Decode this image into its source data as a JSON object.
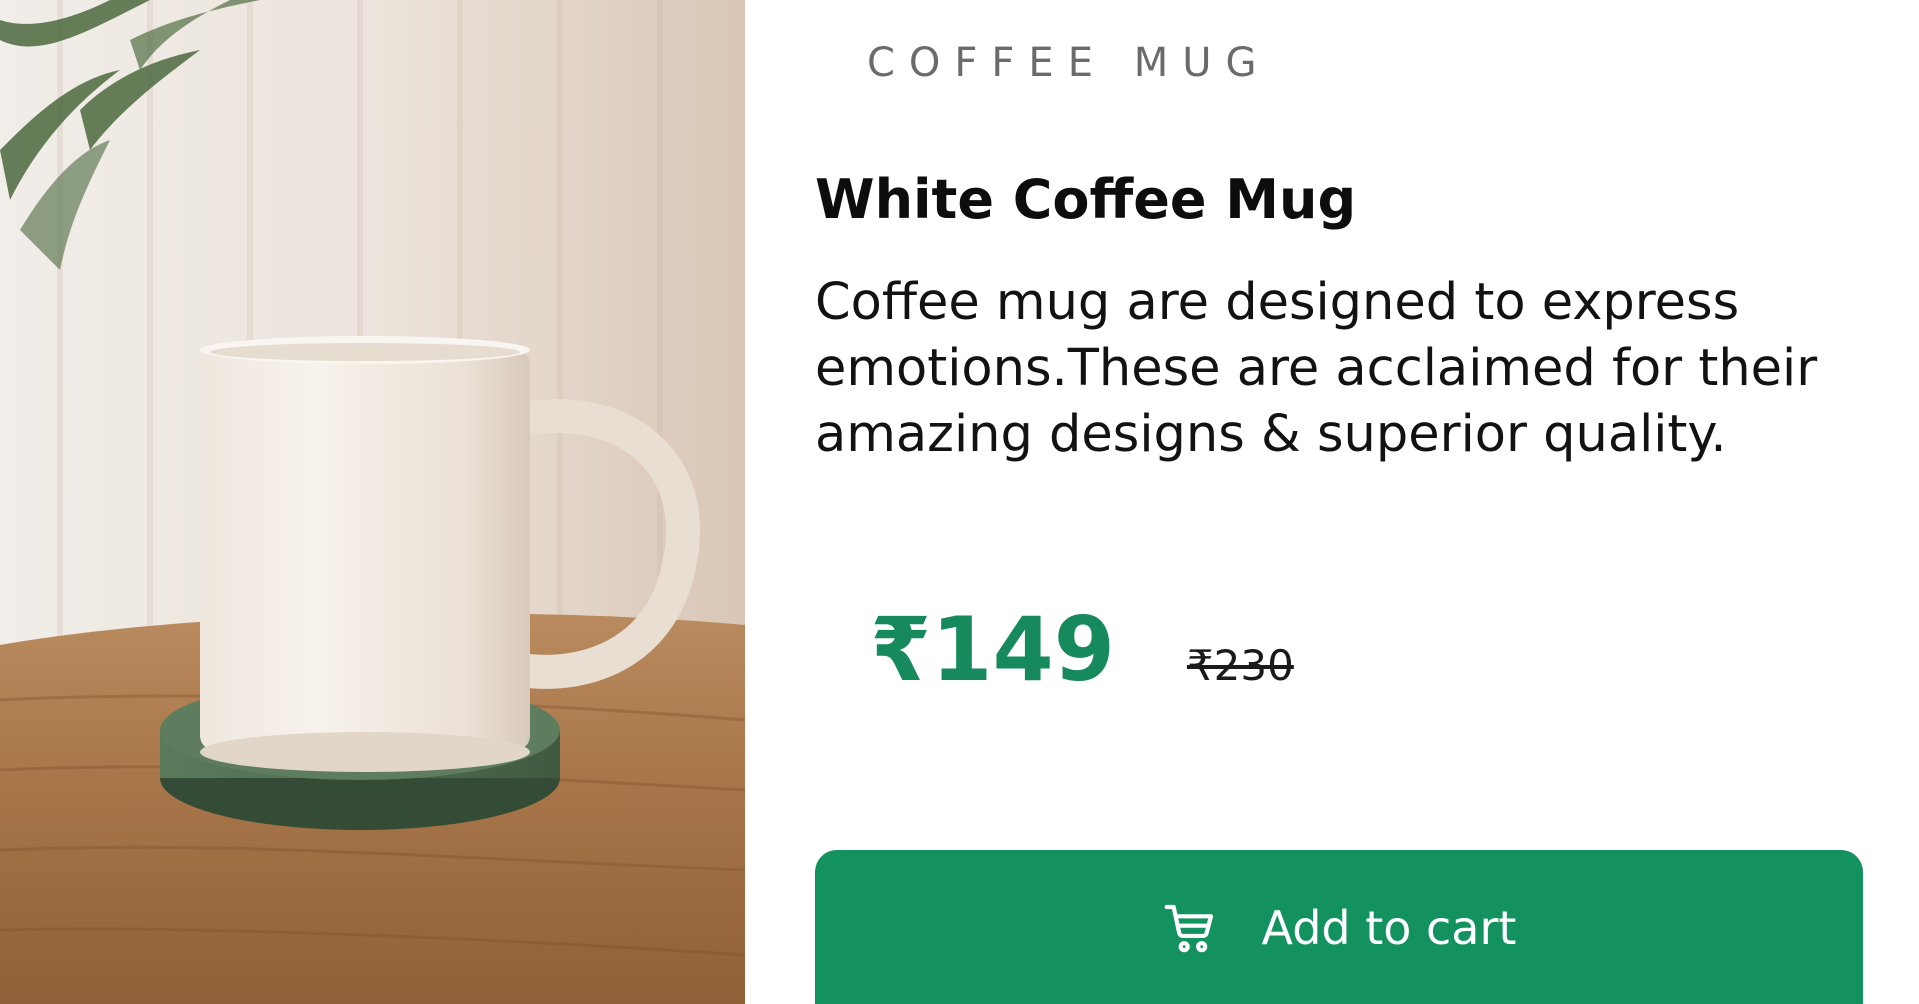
{
  "product": {
    "category": "COFFEE MUG",
    "title": "White Coffee Mug",
    "description": "Coffee mug are designed to express emotions.These are acclaimed for their amazing designs & superior quality.",
    "price": "₹149",
    "original_price": "₹230",
    "add_to_cart_label": "Add to cart",
    "cart_icon": "cart-icon"
  },
  "colors": {
    "accent": "#13925f",
    "price": "#168a5c"
  }
}
